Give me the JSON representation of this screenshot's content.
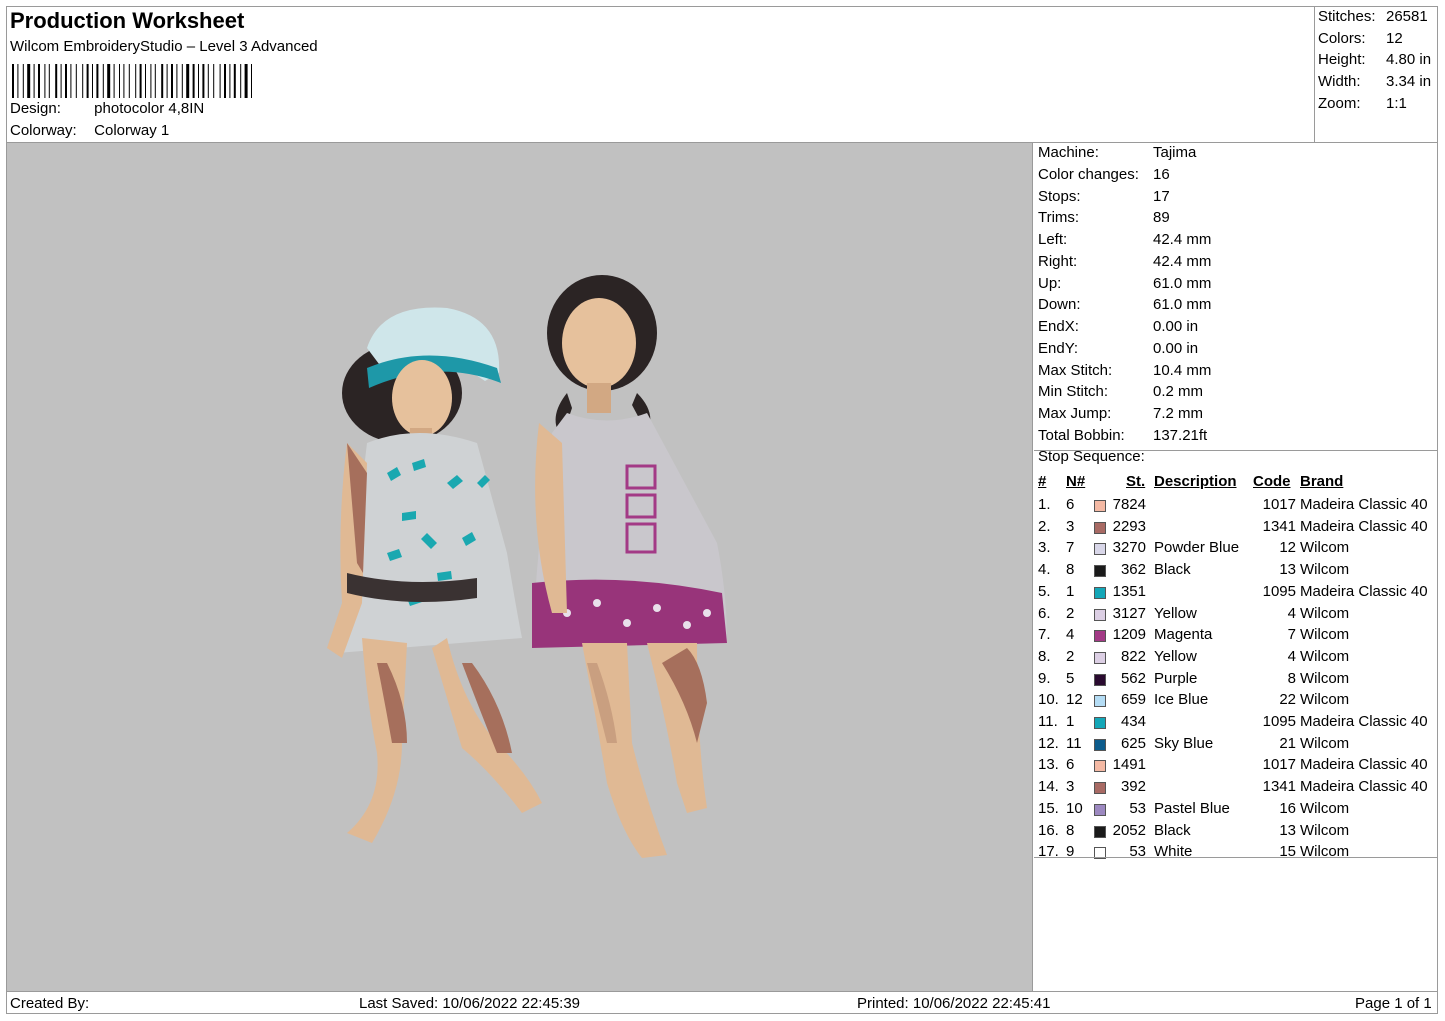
{
  "header": {
    "title": "Production Worksheet",
    "software": "Wilcom EmbroideryStudio – Level 3 Advanced",
    "design_label": "Design:",
    "design_value": "photocolor 4,8IN",
    "colorway_label": "Colorway:",
    "colorway_value": "Colorway 1"
  },
  "stats": [
    {
      "label": "Stitches:",
      "value": "26581"
    },
    {
      "label": "Colors:",
      "value": "12"
    },
    {
      "label": "Height:",
      "value": "4.80 in"
    },
    {
      "label": "Width:",
      "value": "3.34 in"
    },
    {
      "label": "Zoom:",
      "value": "1:1"
    }
  ],
  "machine_info": [
    {
      "label": "Machine:",
      "value": "Tajima"
    },
    {
      "label": "Color changes:",
      "value": "16"
    },
    {
      "label": "Stops:",
      "value": "17"
    },
    {
      "label": "Trims:",
      "value": "89"
    },
    {
      "label": "Left:",
      "value": "42.4 mm"
    },
    {
      "label": "Right:",
      "value": "42.4 mm"
    },
    {
      "label": "Up:",
      "value": "61.0 mm"
    },
    {
      "label": "Down:",
      "value": "61.0 mm"
    },
    {
      "label": "EndX:",
      "value": "0.00 in"
    },
    {
      "label": "EndY:",
      "value": "0.00 in"
    },
    {
      "label": "Max Stitch:",
      "value": "10.4 mm"
    },
    {
      "label": "Min Stitch:",
      "value": "0.2 mm"
    },
    {
      "label": "Max Jump:",
      "value": "7.2 mm"
    },
    {
      "label": "Total Bobbin:",
      "value": "137.21ft"
    }
  ],
  "stop_sequence": {
    "title": "Stop Sequence:",
    "headers": {
      "idx": "#",
      "n": "N#",
      "st": "St.",
      "desc": "Description",
      "code": "Code",
      "brand": "Brand"
    },
    "rows": [
      {
        "idx": "1.",
        "n": "6",
        "color": "#f4b9a4",
        "st": "7824",
        "desc": "",
        "code": "1017",
        "brand": "Madeira Classic 40"
      },
      {
        "idx": "2.",
        "n": "3",
        "color": "#a86a64",
        "st": "2293",
        "desc": "",
        "code": "1341",
        "brand": "Madeira Classic 40"
      },
      {
        "idx": "3.",
        "n": "7",
        "color": "#d8d6e8",
        "st": "3270",
        "desc": "Powder Blue",
        "code": "12",
        "brand": "Wilcom"
      },
      {
        "idx": "4.",
        "n": "8",
        "color": "#1a1a1a",
        "st": "362",
        "desc": "Black",
        "code": "13",
        "brand": "Wilcom"
      },
      {
        "idx": "5.",
        "n": "1",
        "color": "#14a7b8",
        "st": "1351",
        "desc": "",
        "code": "1095",
        "brand": "Madeira Classic 40"
      },
      {
        "idx": "6.",
        "n": "2",
        "color": "#dccfe4",
        "st": "3127",
        "desc": "Yellow",
        "code": "4",
        "brand": "Wilcom"
      },
      {
        "idx": "7.",
        "n": "4",
        "color": "#a33a86",
        "st": "1209",
        "desc": "Magenta",
        "code": "7",
        "brand": "Wilcom"
      },
      {
        "idx": "8.",
        "n": "2",
        "color": "#dccfe4",
        "st": "822",
        "desc": "Yellow",
        "code": "4",
        "brand": "Wilcom"
      },
      {
        "idx": "9.",
        "n": "5",
        "color": "#2a0a30",
        "st": "562",
        "desc": "Purple",
        "code": "8",
        "brand": "Wilcom"
      },
      {
        "idx": "10.",
        "n": "12",
        "color": "#b4dcf4",
        "st": "659",
        "desc": "Ice Blue",
        "code": "22",
        "brand": "Wilcom"
      },
      {
        "idx": "11.",
        "n": "1",
        "color": "#14a7b8",
        "st": "434",
        "desc": "",
        "code": "1095",
        "brand": "Madeira Classic 40"
      },
      {
        "idx": "12.",
        "n": "11",
        "color": "#0c5c8c",
        "st": "625",
        "desc": "Sky Blue",
        "code": "21",
        "brand": "Wilcom"
      },
      {
        "idx": "13.",
        "n": "6",
        "color": "#f4b9a4",
        "st": "1491",
        "desc": "",
        "code": "1017",
        "brand": "Madeira Classic 40"
      },
      {
        "idx": "14.",
        "n": "3",
        "color": "#a86a64",
        "st": "392",
        "desc": "",
        "code": "1341",
        "brand": "Madeira Classic 40"
      },
      {
        "idx": "15.",
        "n": "10",
        "color": "#9c88c0",
        "st": "53",
        "desc": "Pastel Blue",
        "code": "16",
        "brand": "Wilcom"
      },
      {
        "idx": "16.",
        "n": "8",
        "color": "#1a1a1a",
        "st": "2052",
        "desc": "Black",
        "code": "13",
        "brand": "Wilcom"
      },
      {
        "idx": "17.",
        "n": "9",
        "color": "#ffffff",
        "st": "53",
        "desc": "White",
        "code": "15",
        "brand": "Wilcom"
      }
    ]
  },
  "footer": {
    "created_by": "Created By:",
    "last_saved": "Last Saved: 10/06/2022 22:45:39",
    "printed": "Printed: 10/06/2022 22:45:41",
    "page": "Page 1 of 1"
  }
}
